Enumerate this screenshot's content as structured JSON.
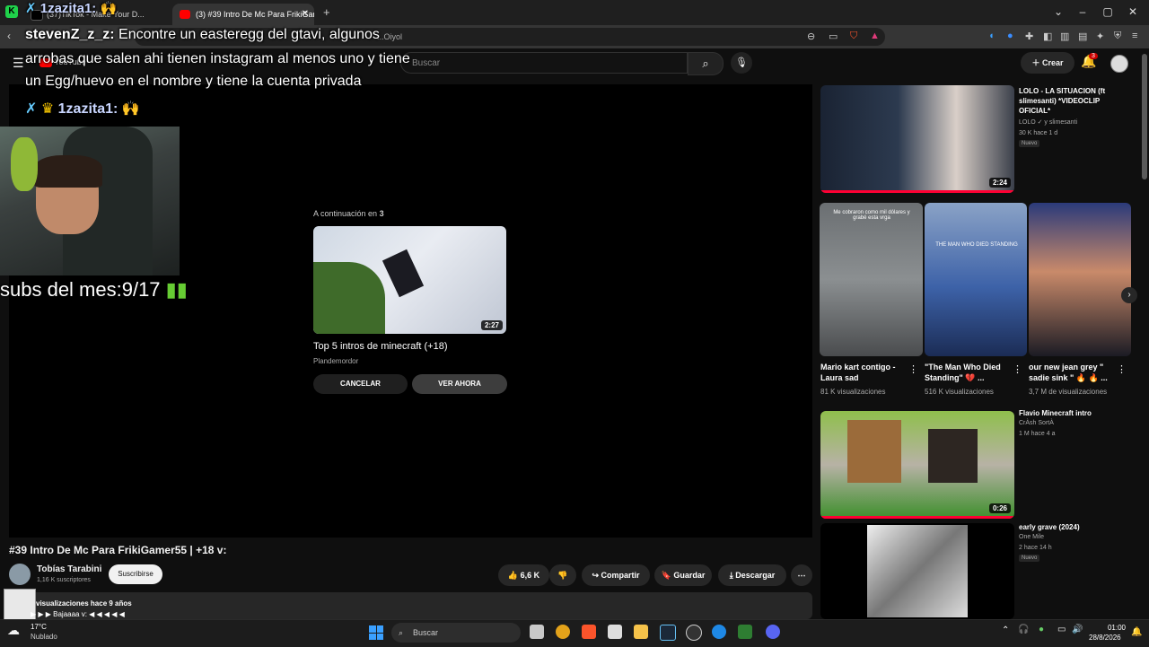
{
  "browser": {
    "tabs": [
      {
        "label": "(37)TikTok - Make Your D..."
      },
      {
        "label": "(3) #39 Intro De Mc Para FrikiGam..."
      }
    ],
    "new_tab": "+",
    "address_text": "...Oiyol"
  },
  "youtube": {
    "logo": "YouTube",
    "search_placeholder": "Buscar",
    "create_label": "Crear",
    "notif_count": "3"
  },
  "player": {
    "up_next_prefix": "A continuación en",
    "up_next_count": "3",
    "next_video": {
      "title": "Top 5 intros de minecraft (+18)",
      "channel": "Plandemordor",
      "duration": "2:27"
    },
    "cancel_label": "CANCELAR",
    "watch_label": "VER AHORA"
  },
  "overlay": {
    "chat1_top_user": "1zazita1:",
    "chat2_user": "stevenZ_z_z:",
    "chat2_line1": "Encontre un easteregg del gtavi, algunos",
    "chat2_line2": "arrobas que salen ahi tienen instagram al menos uno y tiene",
    "chat2_line3": "un Egg/huevo en el nombre y tiene la cuenta privada",
    "chat3_user": "1zazita1:",
    "subs_text": "subs del mes:9/17"
  },
  "video": {
    "title": "#39 Intro De Mc Para FrikiGamer55 | +18 v:",
    "channel_name": "Tobías Tarabini",
    "channel_subs": "1,16 K suscriptores",
    "subscribe_label": "Suscribirse",
    "likes": "6,6 K",
    "share_label": "Compartir",
    "save_label": "Guardar",
    "download_label": "Descargar",
    "desc_meta": "visualizaciones  hace 9 años",
    "desc_line": "▶ ▶ ▶ Bajaaaa v: ◀ ◀ ◀ ◀ ◀"
  },
  "sidebar": {
    "video1": {
      "title": "LOLO - LA SITUACION (ft slimesanti) *VIDEOCLIP OFICIAL*",
      "channel": "LOLO ✓ y slimesanti",
      "meta": "30 K  hace 1 d",
      "badge": "Nuevo",
      "duration": "2:24"
    },
    "shorts": [
      {
        "title": "Mario kart contigo - Laura sad",
        "views": "81 K visualizaciones",
        "caption": "Me cobraron como mil dólares y grabé esta vrga"
      },
      {
        "title": "\"The Man Who Died Standing\" 💔 ...",
        "views": "516 K visualizaciones",
        "caption": "THE MAN WHO DIED STANDING"
      },
      {
        "title": "our new jean grey \" sadie sink \" 🔥 🔥 ...",
        "views": "3,7 M de visualizaciones",
        "caption": ""
      }
    ],
    "video2": {
      "title": "Flavio Minecraft intro",
      "channel": "CrÀsh SortÀ",
      "meta": "1 M  hace 4 a",
      "duration": "0:26"
    },
    "video3": {
      "title": "early grave (2024)",
      "channel": "One Mile",
      "meta": "2  hace 14 h",
      "badge": "Nuevo"
    }
  },
  "taskbar": {
    "temp": "17°C",
    "weather": "Nublado",
    "search": "Buscar",
    "time": "01:00",
    "date": "28/8/2026"
  }
}
